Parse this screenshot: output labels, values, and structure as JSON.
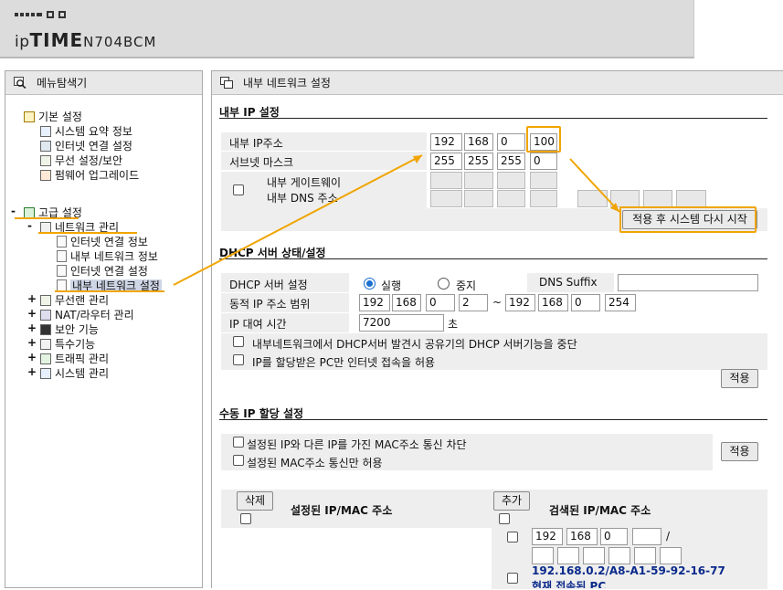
{
  "header": {
    "brand_prefix": "ip",
    "brand_main": "TIME",
    "model": "N704BCM"
  },
  "menu": {
    "title": "메뉴탐색기",
    "items": [
      {
        "label": "기본 설정",
        "expander": ""
      },
      {
        "label": "시스템 요약 정보"
      },
      {
        "label": "인터넷 연결 설정"
      },
      {
        "label": "무선 설정/보안"
      },
      {
        "label": "펌웨어 업그레이드"
      },
      {
        "label": "고급 설정",
        "expander": "-"
      },
      {
        "label": "네트워크 관리",
        "expander": "-"
      },
      {
        "label": "인터넷 연결 정보"
      },
      {
        "label": "내부 네트워크 정보"
      },
      {
        "label": "인터넷 연결 설정"
      },
      {
        "label": "내부 네트워크 설정"
      },
      {
        "label": "무선랜 관리",
        "expander": "+"
      },
      {
        "label": "NAT/라우터 관리",
        "expander": "+"
      },
      {
        "label": "보안 기능",
        "expander": "+"
      },
      {
        "label": "특수기능",
        "expander": "+"
      },
      {
        "label": "트래픽 관리",
        "expander": "+"
      },
      {
        "label": "시스템 관리",
        "expander": "+"
      }
    ]
  },
  "main": {
    "title": "내부 네트워크 설정",
    "internal_ip": {
      "section_title": "내부 IP 설정",
      "ip_label": "내부 IP주소",
      "ip": [
        "192",
        "168",
        "0",
        "100"
      ],
      "mask_label": "서브넷 마스크",
      "mask": [
        "255",
        "255",
        "255",
        "0"
      ],
      "gateway_label": "내부 게이트웨이",
      "dns_label": "내부 DNS 주소",
      "apply_restart_label": "적용 후 시스템 다시 시작"
    },
    "dhcp": {
      "section_title": "DHCP 서버 상태/설정",
      "server_label": "DHCP 서버 설정",
      "run_label": "실행",
      "stop_label": "중지",
      "dns_suffix_label": "DNS Suffix",
      "dns_suffix_value": "",
      "range_label": "동적 IP 주소 범위",
      "range_start": [
        "192",
        "168",
        "0",
        "2"
      ],
      "range_sep": "~",
      "range_end": [
        "192",
        "168",
        "0",
        "254"
      ],
      "lease_label": "IP 대여 시간",
      "lease_value": "7200",
      "lease_unit": "초",
      "opt1_label": "내부네트워크에서 DHCP서버 발견시 공유기의 DHCP 서버기능을 중단",
      "opt2_label": "IP를 할당받은 PC만 인터넷 접속을 허용",
      "apply_label": "적용"
    },
    "manual": {
      "section_title": "수동 IP 할당 설정",
      "opt1_label": "설정된 IP와 다른 IP를 가진 MAC주소 통신 차단",
      "opt2_label": "설정된 MAC주소 통신만 허용",
      "apply_label": "적용",
      "delete_label": "삭제",
      "configured_header": "설정된 IP/MAC 주소",
      "add_label": "추가",
      "detected_header": "검색된 IP/MAC 주소",
      "new_ip": [
        "192",
        "168",
        "0",
        ""
      ],
      "slash": "/",
      "detected_entry": "192.168.0.2/A8-A1-59-92-16-77",
      "detected_note": "현재 접속된 PC"
    }
  },
  "colors": {
    "highlight": "#f0a500",
    "selected_bg": "#cfd6e6",
    "link_blue": "#0a2a8a"
  }
}
